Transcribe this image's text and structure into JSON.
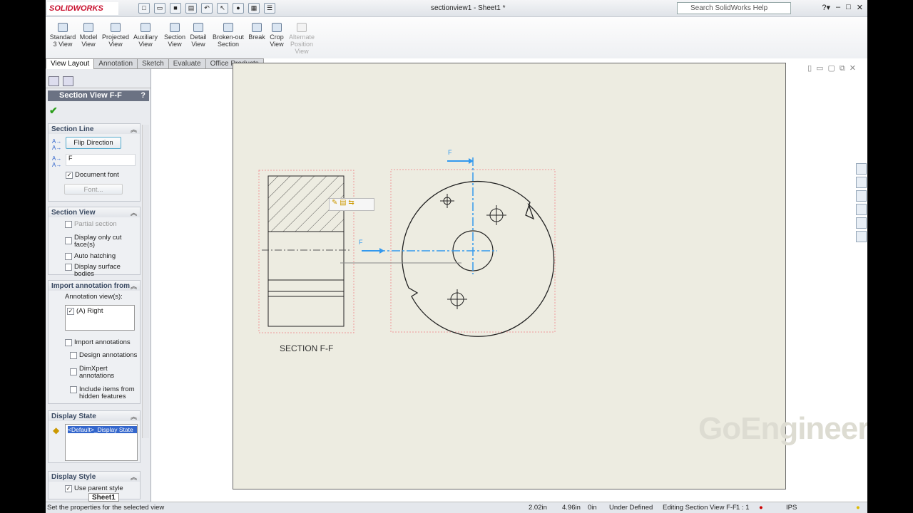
{
  "app": {
    "logo": "SOLIDWORKS",
    "document_title": "sectionview1 - Sheet1 *",
    "search_placeholder": "Search SolidWorks Help"
  },
  "commands": [
    {
      "label": "Standard 3 View"
    },
    {
      "label": "Model View"
    },
    {
      "label": "Projected View"
    },
    {
      "label": "Auxiliary View"
    },
    {
      "label": "Section View"
    },
    {
      "label": "Detail View"
    },
    {
      "label": "Broken-out Section"
    },
    {
      "label": "Break"
    },
    {
      "label": "Crop View"
    },
    {
      "label": "Alternate Position View",
      "disabled": true
    }
  ],
  "tabs": [
    "View Layout",
    "Annotation",
    "Sketch",
    "Evaluate",
    "Office Products"
  ],
  "property_manager": {
    "title": "Section View F-F",
    "help": "?",
    "section_line": {
      "header": "Section Line",
      "flip_button": "Flip Direction",
      "label_value": "F",
      "document_font": "Document font",
      "document_font_checked": true,
      "font_button": "Font..."
    },
    "section_view": {
      "header": "Section View",
      "options": [
        {
          "label": "Partial section",
          "checked": false,
          "disabled": true
        },
        {
          "label": "Display only cut face(s)",
          "checked": false
        },
        {
          "label": "Auto hatching",
          "checked": false
        },
        {
          "label": "Display surface bodies",
          "checked": false
        }
      ]
    },
    "import_annotation": {
      "header": "Import annotation from",
      "views_label": "Annotation view(s):",
      "views": [
        {
          "label": "(A) Right",
          "checked": true
        }
      ],
      "import_annotations": "Import annotations",
      "design_annotations": "Design annotations",
      "dimxpert_annotations": "DimXpert annotations",
      "include_hidden": "Include items from hidden features"
    },
    "display_state": {
      "header": "Display State",
      "selected": "<Default>_Display State"
    },
    "display_style": {
      "header": "Display Style",
      "use_parent": "Use parent style",
      "use_parent_checked": true
    }
  },
  "drawing": {
    "section_caption": "SECTION F-F",
    "section_label_top": "F",
    "section_label_side": "F",
    "watermark": "GoEngineer"
  },
  "sheet_tab": "Sheet1",
  "status": {
    "message": "Set the properties for the selected view",
    "x": "2.02in",
    "y": "4.96in",
    "z": "0in",
    "definition": "Under Defined",
    "mode": "Editing Section View F-F",
    "scale": "1 : 1",
    "units": "IPS"
  }
}
